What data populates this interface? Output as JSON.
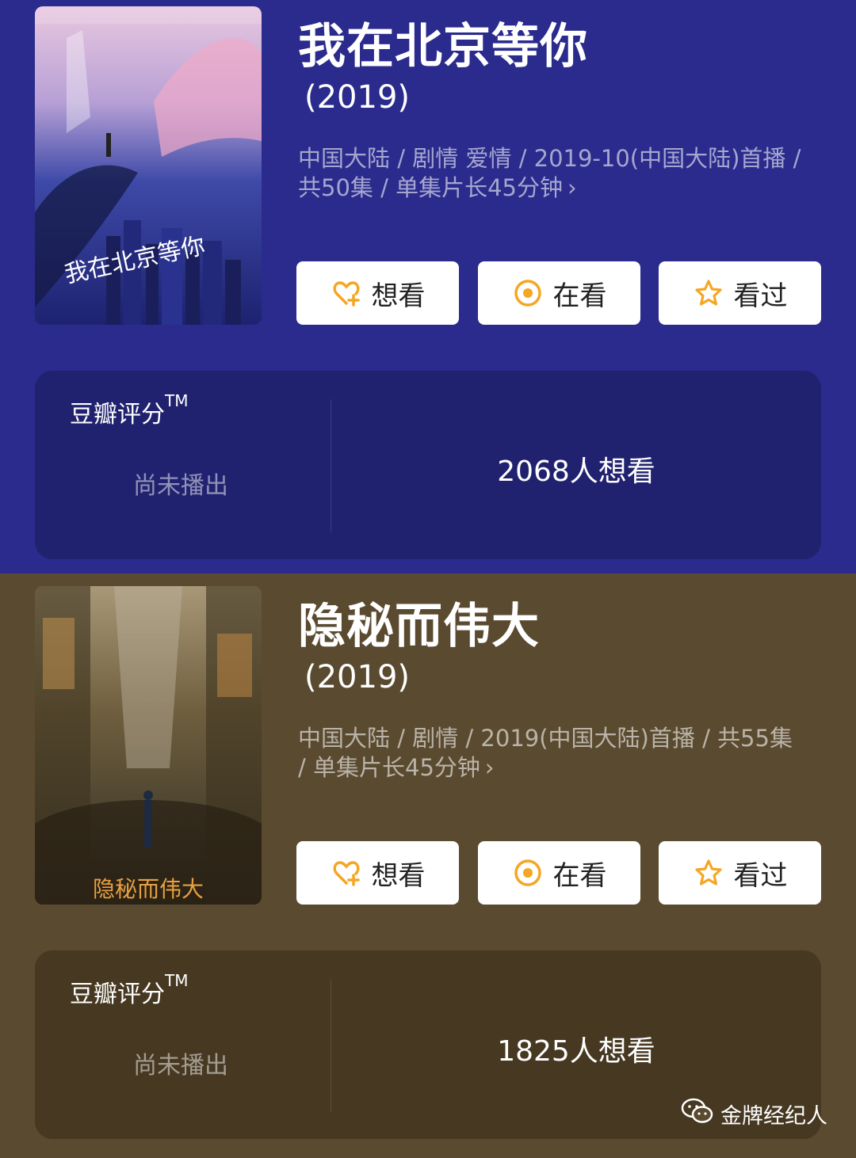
{
  "shows": [
    {
      "title": "我在北京等你",
      "year": "(2019)",
      "meta": "中国大陆 / 剧情 爱情 / 2019-10(中国大陆)首播 / 共50集 / 单集片长45分钟",
      "chevron": "›",
      "poster_title": "我在北京等你",
      "buttons": {
        "want": "想看",
        "watching": "在看",
        "watched": "看过"
      },
      "rating": {
        "label": "豆瓣评分",
        "tm": "TM",
        "status": "尚未播出",
        "wish_count": "2068人想看"
      }
    },
    {
      "title": "隐秘而伟大",
      "year": "(2019)",
      "meta": "中国大陆 / 剧情 / 2019(中国大陆)首播 / 共55集 / 单集片长45分钟",
      "chevron": "›",
      "poster_title": "隐秘而伟大",
      "buttons": {
        "want": "想看",
        "watching": "在看",
        "watched": "看过"
      },
      "rating": {
        "label": "豆瓣评分",
        "tm": "TM",
        "status": "尚未播出",
        "wish_count": "1825人想看"
      }
    }
  ],
  "watermark": {
    "text": "金牌经纪人",
    "icon": "wechat-icon"
  },
  "colors": {
    "panel1_bg": "#2a2b8c",
    "panel2_bg": "#5a4a30",
    "accent": "#f5a623"
  }
}
